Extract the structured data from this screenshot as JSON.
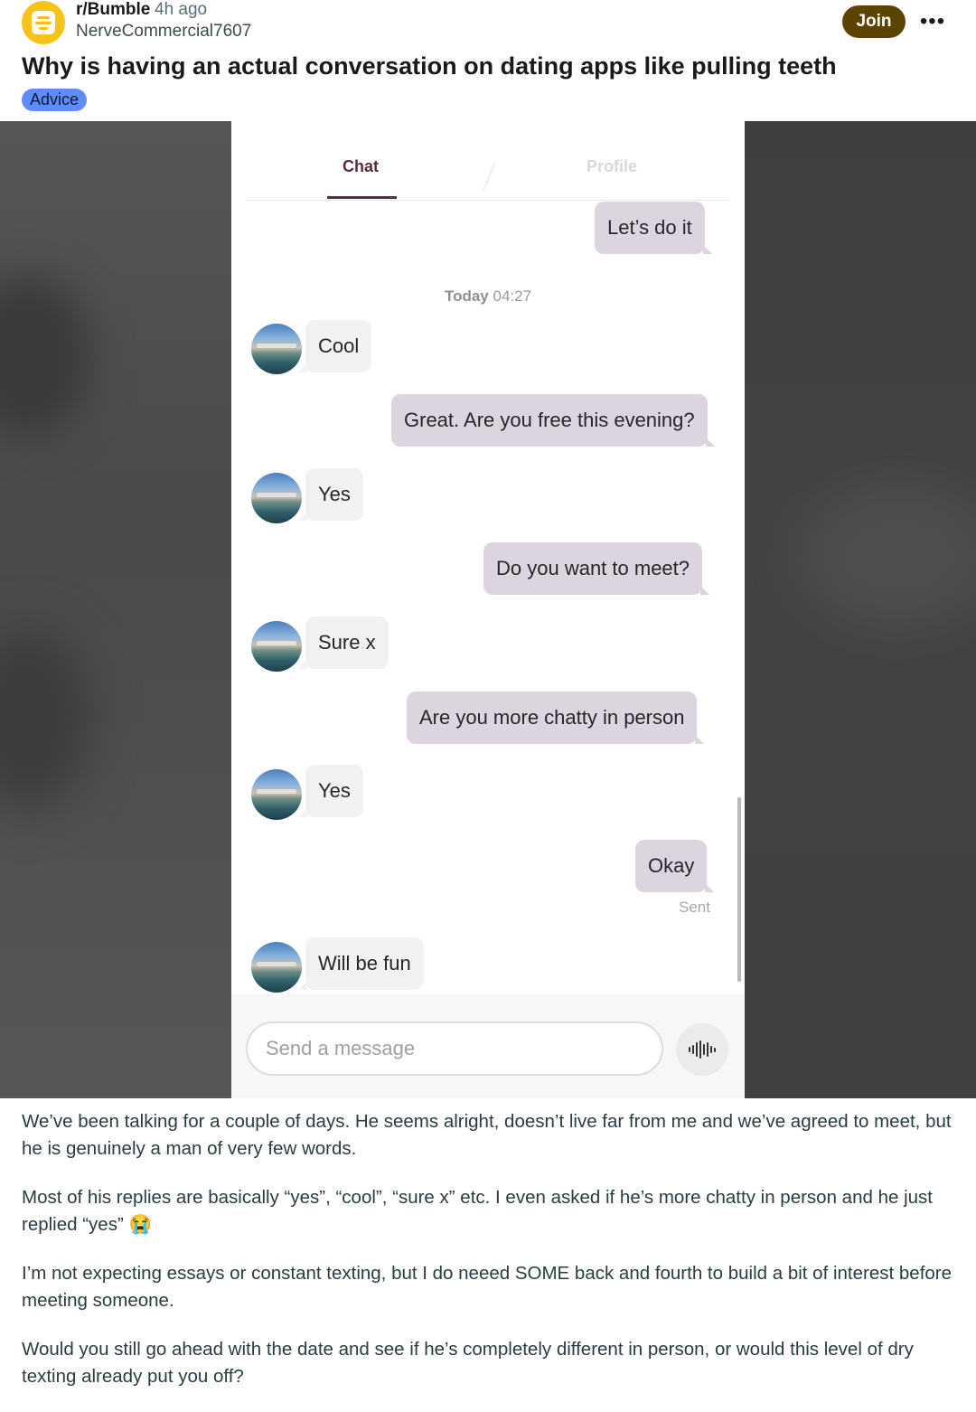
{
  "post": {
    "subreddit": "r/Bumble",
    "time_ago": "4h ago",
    "author": "NerveCommercial7607",
    "join_label": "Join",
    "more_label": "•••",
    "title": "Why is having an actual conversation on dating apps like pulling teeth",
    "flair": "Advice",
    "paragraphs": [
      "We’ve been talking for a couple of days. He seems alright, doesn’t live far from me and we’ve agreed to meet, but he is genuinely a man of very few words.",
      "Most of his replies are basically “yes”, “cool”, “sure x” etc. I even asked if he’s more chatty in person and he just replied “yes” 😭",
      "I’m not expecting essays or constant texting, but I do neeed SOME back and fourth to build a bit of interest before meeting someone.",
      "Would you still go ahead with the date and see if he’s completely different in person, or would this level of dry texting already put you off?"
    ]
  },
  "chat": {
    "tabs": {
      "chat": "Chat",
      "profile": "Profile"
    },
    "timestamp_day": "Today",
    "timestamp_time": "04:27",
    "messages": [
      {
        "from": "me",
        "text": "Let’s do it"
      },
      {
        "from": "them",
        "text": "Cool"
      },
      {
        "from": "me",
        "text": "Great. Are you free this evening?"
      },
      {
        "from": "them",
        "text": "Yes"
      },
      {
        "from": "me",
        "text": "Do you want to meet?"
      },
      {
        "from": "them",
        "text": "Sure x"
      },
      {
        "from": "me",
        "text": "Are you more chatty in person"
      },
      {
        "from": "them",
        "text": "Yes"
      },
      {
        "from": "me",
        "text": "Okay"
      },
      {
        "from": "them",
        "text": "Will be fun"
      }
    ],
    "sent_label": "Sent",
    "input_placeholder": "Send a message",
    "icons": {
      "voice": "voice-wave-icon",
      "avatar": "match-avatar"
    }
  },
  "colors": {
    "subreddit_icon": "#f7c31a",
    "join_button": "#5c4400",
    "flair": "#5f8cf7",
    "tab_active": "#5a2a3f",
    "outgoing_bubble": "#dcd5df",
    "incoming_bubble": "#f2f2f2"
  }
}
